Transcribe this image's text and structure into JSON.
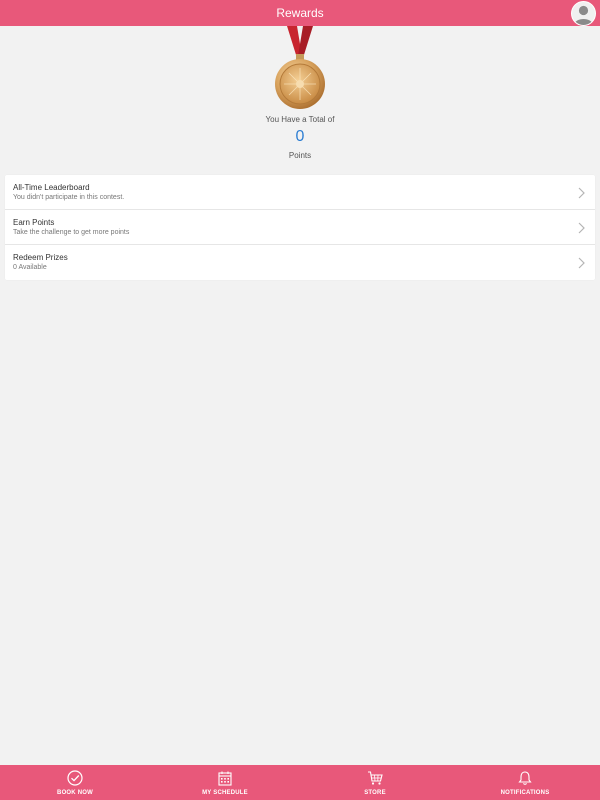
{
  "header": {
    "title": "Rewards",
    "avatar_icon": "user-avatar-icon"
  },
  "summary": {
    "total_label": "You Have a Total of",
    "points_value": "0",
    "points_label": "Points",
    "medal_icon": "gold-medal-icon"
  },
  "list": {
    "items": [
      {
        "title": "All-Time Leaderboard",
        "subtitle": "You didn't participate in this contest."
      },
      {
        "title": "Earn Points",
        "subtitle": "Take the challenge to get more points"
      },
      {
        "title": "Redeem Prizes",
        "subtitle": "0 Available"
      }
    ]
  },
  "bottom_nav": {
    "tabs": [
      {
        "label": "BOOK NOW",
        "icon": "checkmark-circle-icon"
      },
      {
        "label": "MY SCHEDULE",
        "icon": "calendar-icon"
      },
      {
        "label": "STORE",
        "icon": "cart-icon"
      },
      {
        "label": "NOTIFICATIONS",
        "icon": "bell-icon"
      }
    ]
  },
  "colors": {
    "brand_pink": "#e8587a",
    "accent_blue": "#2f7fd3",
    "background": "#f2f2f2"
  }
}
